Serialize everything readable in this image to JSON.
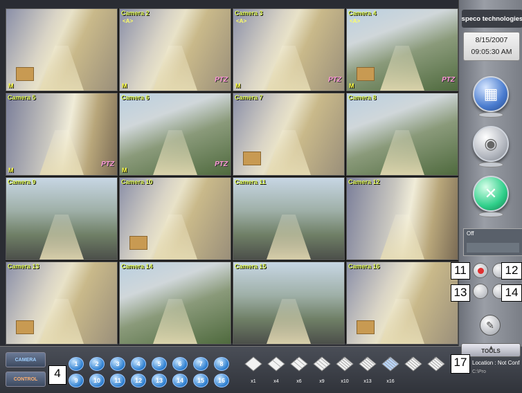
{
  "cameras": [
    {
      "title": "",
      "arrow": "",
      "m": "M",
      "ptz": ""
    },
    {
      "title": "Camera 2",
      "arrow": "<A>",
      "m": "M",
      "ptz": "PTZ"
    },
    {
      "title": "Camera 3",
      "arrow": "<A>",
      "m": "M",
      "ptz": "PTZ"
    },
    {
      "title": "Camera 4",
      "arrow": "<A>",
      "m": "M",
      "ptz": "PTZ"
    },
    {
      "title": "Camera 5",
      "arrow": "",
      "m": "M",
      "ptz": "PTZ"
    },
    {
      "title": "Camera 6",
      "arrow": "",
      "m": "M",
      "ptz": "PTZ"
    },
    {
      "title": "Camera 7",
      "arrow": "",
      "m": "",
      "ptz": ""
    },
    {
      "title": "Camera 8",
      "arrow": "",
      "m": "",
      "ptz": ""
    },
    {
      "title": "Camera 9",
      "arrow": "",
      "m": "",
      "ptz": ""
    },
    {
      "title": "Camera 10",
      "arrow": "",
      "m": "",
      "ptz": ""
    },
    {
      "title": "Camera 11",
      "arrow": "",
      "m": "",
      "ptz": ""
    },
    {
      "title": "Camera 12",
      "arrow": "",
      "m": "",
      "ptz": ""
    },
    {
      "title": "Camera 13",
      "arrow": "",
      "m": "",
      "ptz": ""
    },
    {
      "title": "Camera 14",
      "arrow": "",
      "m": "",
      "ptz": ""
    },
    {
      "title": "Camera 15",
      "arrow": "",
      "m": "",
      "ptz": ""
    },
    {
      "title": "Camera 16",
      "arrow": "",
      "m": "",
      "ptz": ""
    }
  ],
  "side": {
    "logo": "speco technologies",
    "date": "8/15/2007",
    "time": "09:05:30 AM",
    "status": "Off"
  },
  "callouts": {
    "c11": "11",
    "c12": "12",
    "c13": "13",
    "c14": "14",
    "c4": "4",
    "c17": "17"
  },
  "bottom": {
    "tab_camera": "CAMERA",
    "tab_control": "CONTROL",
    "numbers": [
      "1",
      "2",
      "3",
      "4",
      "5",
      "6",
      "7",
      "8",
      "9",
      "10",
      "11",
      "12",
      "13",
      "14",
      "15",
      "16"
    ],
    "splits": [
      "x1",
      "x4",
      "x6",
      "x9",
      "x10",
      "x13",
      "x16",
      "",
      ""
    ],
    "tools": "TOOLS",
    "location": "Location : Not Conf",
    "location_sub": "C:\\Pro"
  }
}
